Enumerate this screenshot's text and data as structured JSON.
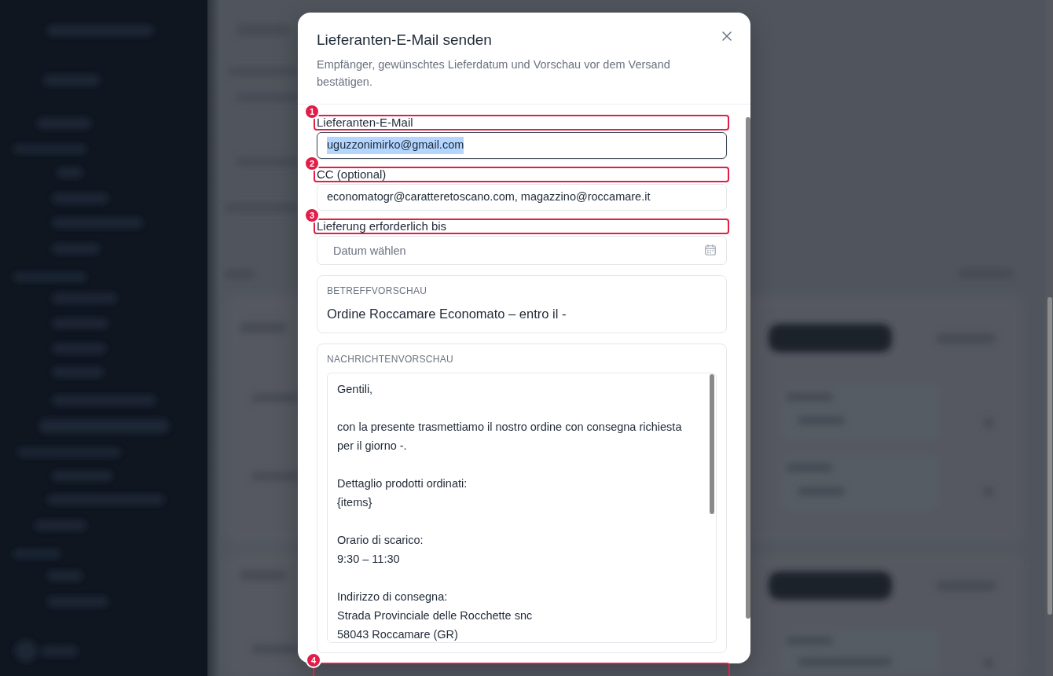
{
  "dialog": {
    "title": "Lieferanten-E-Mail senden",
    "subtitle": "Empfänger, gewünschtes Lieferdatum und Vorschau vor dem Versand bestätigen.",
    "fields": [
      {
        "kind": "text",
        "label": "Lieferanten-E-Mail",
        "value": "uguzzonimirko@gmail.com",
        "focused": true,
        "text_selected": true
      },
      {
        "kind": "text",
        "label": "CC (optional)",
        "value": "economatogr@caratteretoscano.com, magazzino@roccamare.it",
        "focused": false,
        "text_selected": false
      },
      {
        "kind": "date",
        "label": "Lieferung erforderlich bis",
        "placeholder": "Datum wählen",
        "focused": false
      }
    ],
    "subject_preview": {
      "label": "BETREFFVORSCHAU",
      "text": "Ordine Roccamare Economato – entro il -"
    },
    "message_preview": {
      "label": "NACHRICHTENVORSCHAU",
      "text": "Gentili,\n\ncon la presente trasmettiamo il nostro ordine con consegna richiesta per il giorno -.\n\nDettaglio prodotti ordinati:\n{items}\n\nOrario di scarico:\n9:30 – 11:30\n\nIndirizzo di consegna:\nStrada Provinciale delle Rocchette snc\n58043 Roccamare (GR)"
    }
  },
  "annotations": [
    {
      "number": "1"
    },
    {
      "number": "2"
    },
    {
      "number": "3"
    },
    {
      "number": "4"
    }
  ]
}
